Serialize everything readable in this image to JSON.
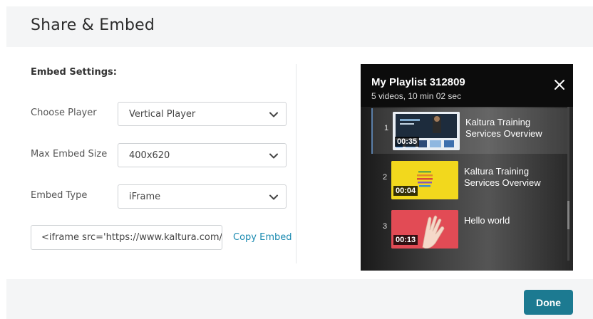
{
  "dialog": {
    "title": "Share & Embed"
  },
  "settings": {
    "section_title": "Embed Settings:",
    "choose_player": {
      "label": "Choose Player",
      "value": "Vertical Player"
    },
    "max_embed_size": {
      "label": "Max Embed Size",
      "value": "400x620"
    },
    "embed_type": {
      "label": "Embed Type",
      "value": "iFrame"
    },
    "embed_code": {
      "value": "<iframe src='https://www.kaltura.com/p/"
    },
    "copy_embed_label": "Copy Embed"
  },
  "player": {
    "playlist_title": "My Playlist 312809",
    "playlist_meta": "5 videos, 10 min 02 sec",
    "items": [
      {
        "index": "1",
        "title": "Kaltura Training Services Overview",
        "duration": "00:35",
        "thumb": "screen"
      },
      {
        "index": "2",
        "title": "Kaltura Training Services Overview",
        "duration": "00:04",
        "thumb": "yellow"
      },
      {
        "index": "3",
        "title": "Hello world",
        "duration": "00:13",
        "thumb": "red"
      }
    ]
  },
  "footer": {
    "done_label": "Done"
  },
  "colors": {
    "accent": "#1c7a91",
    "link": "#1a8ab0",
    "player_bg": "#0c0c0c"
  }
}
